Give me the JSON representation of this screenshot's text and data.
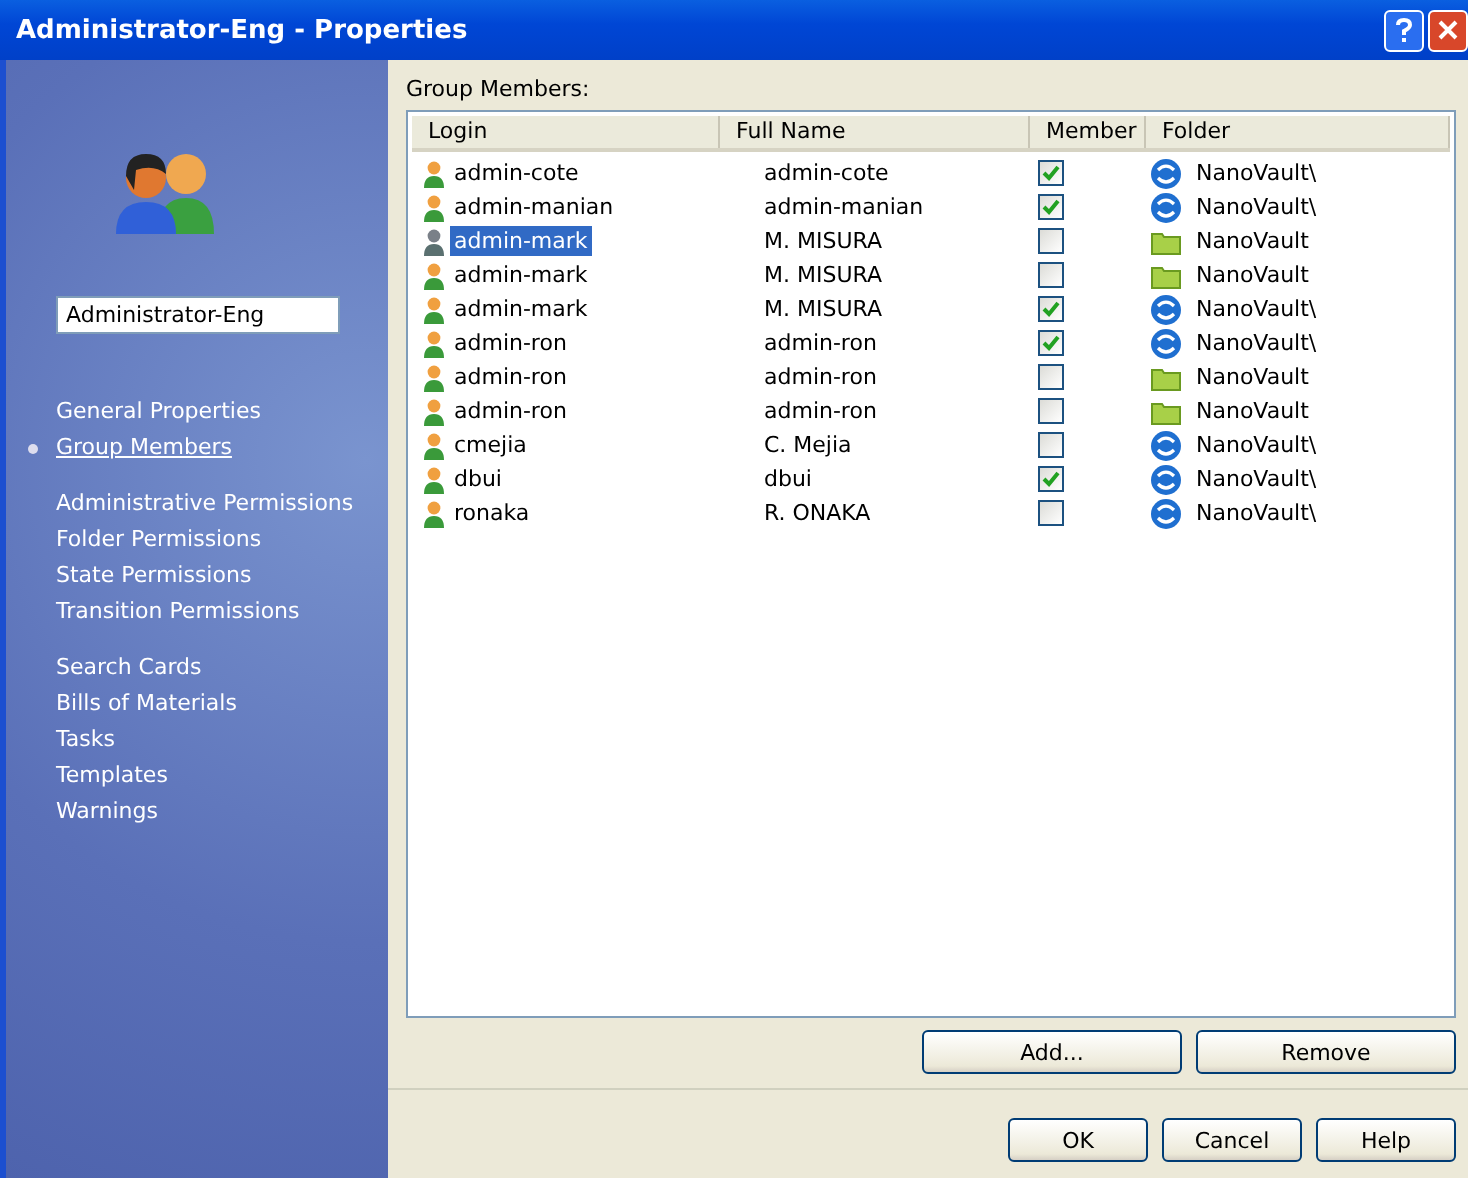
{
  "window": {
    "title": "Administrator-Eng - Properties"
  },
  "sidebar": {
    "group_name": "Administrator-Eng",
    "nav_groups": [
      [
        {
          "label": "General Properties",
          "selected": false
        },
        {
          "label": "Group Members",
          "selected": true
        }
      ],
      [
        {
          "label": "Administrative Permissions",
          "selected": false
        },
        {
          "label": "Folder Permissions",
          "selected": false
        },
        {
          "label": "State Permissions",
          "selected": false
        },
        {
          "label": "Transition Permissions",
          "selected": false
        }
      ],
      [
        {
          "label": "Search Cards",
          "selected": false
        },
        {
          "label": "Bills of Materials",
          "selected": false
        },
        {
          "label": "Tasks",
          "selected": false
        },
        {
          "label": "Templates",
          "selected": false
        },
        {
          "label": "Warnings",
          "selected": false
        }
      ]
    ]
  },
  "members": {
    "label": "Group Members:",
    "columns": [
      "Login",
      "Full Name",
      "Member",
      "Folder"
    ],
    "rows": [
      {
        "login": "admin-cote",
        "full_name": "admin-cote",
        "member": true,
        "folder": "NanoVault\\",
        "kind": "vault",
        "inactive": false,
        "selected": false
      },
      {
        "login": "admin-manian",
        "full_name": "admin-manian",
        "member": true,
        "folder": "NanoVault\\",
        "kind": "vault",
        "inactive": false,
        "selected": false
      },
      {
        "login": "admin-mark",
        "full_name": "M. MISURA",
        "member": false,
        "folder": "NanoVault",
        "kind": "folder",
        "inactive": true,
        "selected": true
      },
      {
        "login": "admin-mark",
        "full_name": "M. MISURA",
        "member": false,
        "folder": "NanoVault",
        "kind": "folder",
        "inactive": false,
        "selected": false
      },
      {
        "login": "admin-mark",
        "full_name": "M. MISURA",
        "member": true,
        "folder": "NanoVault\\",
        "kind": "vault",
        "inactive": false,
        "selected": false
      },
      {
        "login": "admin-ron",
        "full_name": "admin-ron",
        "member": true,
        "folder": "NanoVault\\",
        "kind": "vault",
        "inactive": false,
        "selected": false
      },
      {
        "login": "admin-ron",
        "full_name": "admin-ron",
        "member": false,
        "folder": "NanoVault",
        "kind": "folder",
        "inactive": false,
        "selected": false
      },
      {
        "login": "admin-ron",
        "full_name": "admin-ron",
        "member": false,
        "folder": "NanoVault",
        "kind": "folder",
        "inactive": false,
        "selected": false
      },
      {
        "login": "cmejia",
        "full_name": "C. Mejia",
        "member": false,
        "folder": "NanoVault\\",
        "kind": "vault",
        "inactive": false,
        "selected": false
      },
      {
        "login": "dbui",
        "full_name": "dbui",
        "member": true,
        "folder": "NanoVault\\",
        "kind": "vault",
        "inactive": false,
        "selected": false
      },
      {
        "login": "ronaka",
        "full_name": "R. ONAKA",
        "member": false,
        "folder": "NanoVault\\",
        "kind": "vault",
        "inactive": false,
        "selected": false
      }
    ],
    "buttons": [
      "Add...",
      "Remove"
    ]
  },
  "buttons": [
    "OK",
    "Cancel",
    "Help"
  ]
}
